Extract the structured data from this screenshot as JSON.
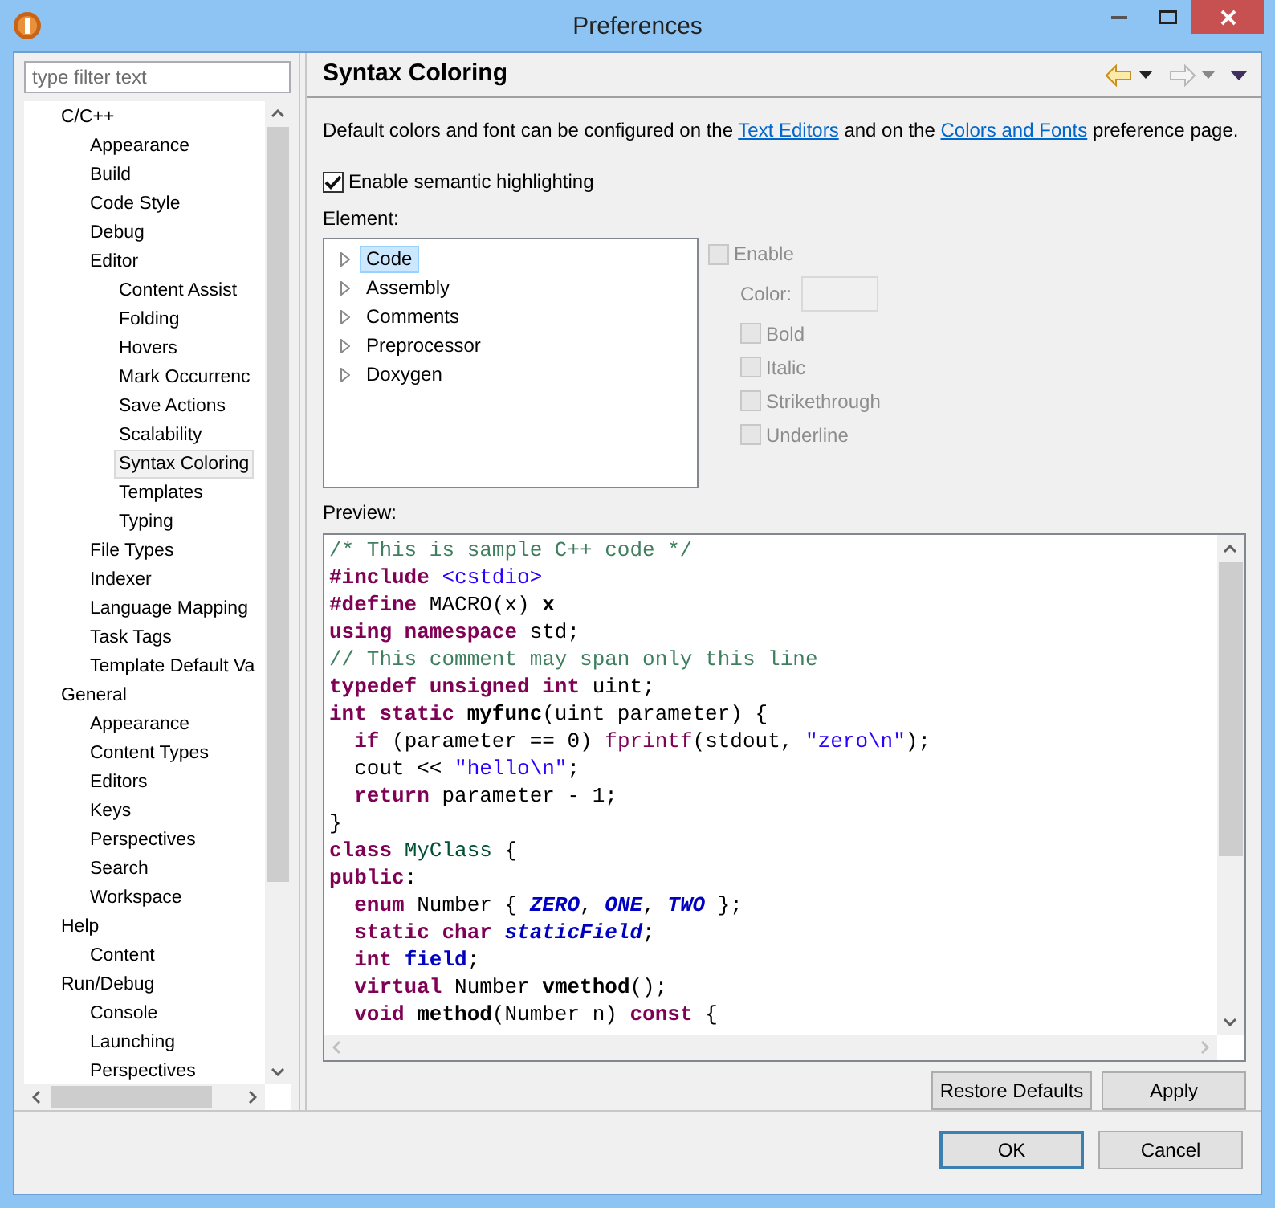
{
  "window": {
    "title": "Preferences"
  },
  "filter": {
    "placeholder": "type filter text"
  },
  "nav_tree": [
    {
      "label": "C/C++",
      "selected": false,
      "children": [
        {
          "label": "Appearance",
          "selected": false
        },
        {
          "label": "Build",
          "selected": false
        },
        {
          "label": "Code Style",
          "selected": false
        },
        {
          "label": "Debug",
          "selected": false
        },
        {
          "label": "Editor",
          "selected": false,
          "children": [
            {
              "label": "Content Assist",
              "selected": false
            },
            {
              "label": "Folding",
              "selected": false
            },
            {
              "label": "Hovers",
              "selected": false
            },
            {
              "label": "Mark Occurrenc",
              "selected": false
            },
            {
              "label": "Save Actions",
              "selected": false
            },
            {
              "label": "Scalability",
              "selected": false
            },
            {
              "label": "Syntax Coloring",
              "selected": true
            },
            {
              "label": "Templates",
              "selected": false
            },
            {
              "label": "Typing",
              "selected": false
            }
          ]
        },
        {
          "label": "File Types",
          "selected": false
        },
        {
          "label": "Indexer",
          "selected": false
        },
        {
          "label": "Language Mapping",
          "selected": false
        },
        {
          "label": "Task Tags",
          "selected": false
        },
        {
          "label": "Template Default Va",
          "selected": false
        }
      ]
    },
    {
      "label": "General",
      "selected": false,
      "children": [
        {
          "label": "Appearance",
          "selected": false
        },
        {
          "label": "Content Types",
          "selected": false
        },
        {
          "label": "Editors",
          "selected": false
        },
        {
          "label": "Keys",
          "selected": false
        },
        {
          "label": "Perspectives",
          "selected": false
        },
        {
          "label": "Search",
          "selected": false
        },
        {
          "label": "Workspace",
          "selected": false
        }
      ]
    },
    {
      "label": "Help",
      "selected": false,
      "children": [
        {
          "label": "Content",
          "selected": false
        }
      ]
    },
    {
      "label": "Run/Debug",
      "selected": false,
      "children": [
        {
          "label": "Console",
          "selected": false
        },
        {
          "label": "Launching",
          "selected": false
        },
        {
          "label": "Perspectives",
          "selected": false
        }
      ]
    }
  ],
  "page": {
    "title": "Syntax Coloring",
    "description": [
      {
        "kind": "text",
        "text": "Default colors and font can be configured on the"
      },
      {
        "kind": "link",
        "text": "Text Editors"
      },
      {
        "kind": "text",
        "text": "and on the"
      },
      {
        "kind": "link",
        "text": "Colors and Fonts"
      },
      {
        "kind": "text",
        "text": "preference page."
      }
    ],
    "semantic_highlighting": {
      "label": "Enable semantic highlighting",
      "checked": true
    },
    "element_label": "Element:",
    "elements": [
      {
        "label": "Code",
        "selected": true,
        "expanded": false
      },
      {
        "label": "Assembly",
        "selected": false,
        "expanded": false
      },
      {
        "label": "Comments",
        "selected": false,
        "expanded": false
      },
      {
        "label": "Preprocessor",
        "selected": false,
        "expanded": false
      },
      {
        "label": "Doxygen",
        "selected": false,
        "expanded": false
      }
    ],
    "enable": {
      "label": "Enable",
      "checked": false,
      "disabled": true
    },
    "color_label": "Color:",
    "styles": [
      {
        "label": "Bold",
        "checked": false,
        "disabled": true
      },
      {
        "label": "Italic",
        "checked": false,
        "disabled": true
      },
      {
        "label": "Strikethrough",
        "checked": false,
        "disabled": true
      },
      {
        "label": "Underline",
        "checked": false,
        "disabled": true
      }
    ],
    "preview_label": "Preview:",
    "preview_lines": [
      [
        {
          "text": "/* This is sample C++ code */",
          "kind": "comment"
        }
      ],
      [
        {
          "text": "#include",
          "kind": "keyword"
        },
        {
          "text": " <cstdio>",
          "kind": "string"
        }
      ],
      [
        {
          "text": "#define",
          "kind": "keyword"
        },
        {
          "text": " MACRO(x) ",
          "kind": "plain"
        },
        {
          "text": "x",
          "kind": "bold"
        }
      ],
      [
        {
          "text": "using namespace",
          "kind": "keyword"
        },
        {
          "text": " std;",
          "kind": "plain"
        }
      ],
      [
        {
          "text": "// This comment may span only this line",
          "kind": "comment"
        }
      ],
      [
        {
          "text": "typedef unsigned int",
          "kind": "keyword"
        },
        {
          "text": " uint;",
          "kind": "plain"
        }
      ],
      [
        {
          "text": "int static",
          "kind": "keyword"
        },
        {
          "text": " myfunc",
          "kind": "bold"
        },
        {
          "text": "(uint parameter) {",
          "kind": "plain"
        }
      ],
      [
        {
          "text": "  if",
          "kind": "keyword"
        },
        {
          "text": " (parameter == 0) ",
          "kind": "plain"
        },
        {
          "text": "fprintf",
          "kind": "external"
        },
        {
          "text": "(stdout, ",
          "kind": "plain"
        },
        {
          "text": "\"zero\\n\"",
          "kind": "string"
        },
        {
          "text": ");",
          "kind": "plain"
        }
      ],
      [
        {
          "text": "  cout << ",
          "kind": "plain"
        },
        {
          "text": "\"hello\\n\"",
          "kind": "string"
        },
        {
          "text": ";",
          "kind": "plain"
        }
      ],
      [
        {
          "text": "  return",
          "kind": "keyword"
        },
        {
          "text": " parameter - 1;",
          "kind": "plain"
        }
      ],
      [
        {
          "text": "}",
          "kind": "plain"
        }
      ],
      [
        {
          "text": "class",
          "kind": "keyword"
        },
        {
          "text": " MyClass",
          "kind": "class"
        },
        {
          "text": " {",
          "kind": "plain"
        }
      ],
      [
        {
          "text": "public",
          "kind": "keyword"
        },
        {
          "text": ":",
          "kind": "plain"
        }
      ],
      [
        {
          "text": "  enum",
          "kind": "keyword"
        },
        {
          "text": " Number { ",
          "kind": "plain"
        },
        {
          "text": "ZERO",
          "kind": "enumerator"
        },
        {
          "text": ", ",
          "kind": "plain"
        },
        {
          "text": "ONE",
          "kind": "enumerator"
        },
        {
          "text": ", ",
          "kind": "plain"
        },
        {
          "text": "TWO",
          "kind": "enumerator"
        },
        {
          "text": " };",
          "kind": "plain"
        }
      ],
      [
        {
          "text": "  static char",
          "kind": "keyword"
        },
        {
          "text": " staticField",
          "kind": "enumerator"
        },
        {
          "text": ";",
          "kind": "plain"
        }
      ],
      [
        {
          "text": "  int",
          "kind": "keyword"
        },
        {
          "text": " field",
          "kind": "field"
        },
        {
          "text": ";",
          "kind": "plain"
        }
      ],
      [
        {
          "text": "  virtual",
          "kind": "keyword"
        },
        {
          "text": " Number ",
          "kind": "plain"
        },
        {
          "text": "vmethod",
          "kind": "bold"
        },
        {
          "text": "();",
          "kind": "plain"
        }
      ],
      [
        {
          "text": "  void",
          "kind": "keyword"
        },
        {
          "text": " method",
          "kind": "bold"
        },
        {
          "text": "(Number n) ",
          "kind": "plain"
        },
        {
          "text": "const",
          "kind": "keyword"
        },
        {
          "text": " {",
          "kind": "plain"
        }
      ]
    ],
    "page_buttons": [
      "Restore Defaults",
      "Apply"
    ]
  },
  "dialog_buttons": [
    {
      "label": "OK",
      "default": true
    },
    {
      "label": "Cancel",
      "default": false
    }
  ]
}
